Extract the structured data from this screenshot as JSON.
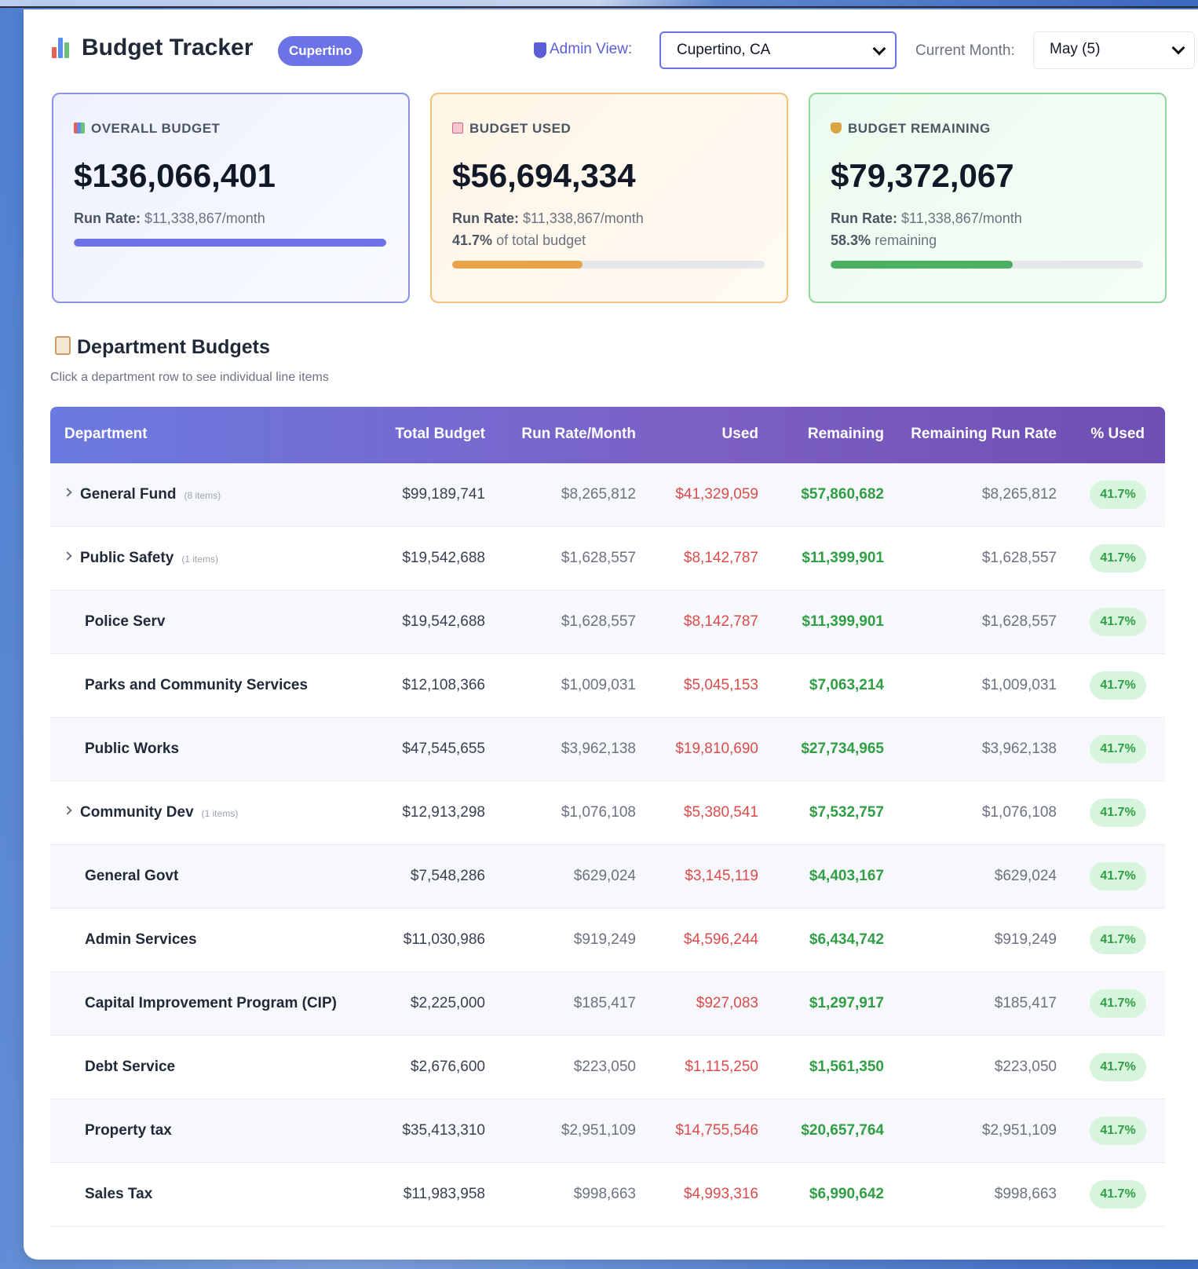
{
  "header": {
    "title": "Budget Tracker",
    "city_badge": "Cupertino",
    "admin_label": "Admin View:",
    "admin_selected": "Cupertino, CA",
    "month_label": "Current Month:",
    "month_selected": "May (5)"
  },
  "cards": {
    "overall": {
      "label": "OVERALL BUDGET",
      "value": "$136,066,401",
      "run_rate_label": "Run Rate:",
      "run_rate_value": "$11,338,867/month",
      "progress": 1.0,
      "color": "#6b73e6"
    },
    "used": {
      "label": "BUDGET USED",
      "value": "$56,694,334",
      "run_rate_label": "Run Rate:",
      "run_rate_value": "$11,338,867/month",
      "pct": "41.7%",
      "pct_text": "of total budget",
      "progress": 0.417,
      "color": "#e8a24a"
    },
    "remaining": {
      "label": "BUDGET REMAINING",
      "value": "$79,372,067",
      "run_rate_label": "Run Rate:",
      "run_rate_value": "$11,338,867/month",
      "pct": "58.3%",
      "pct_text": "remaining",
      "progress": 0.583,
      "color": "#4caf63"
    }
  },
  "section": {
    "title": "Department Budgets",
    "subtitle": "Click a department row to see individual line items"
  },
  "table": {
    "columns": [
      "Department",
      "Total Budget",
      "Run Rate/Month",
      "Used",
      "Remaining",
      "Remaining Run Rate",
      "% Used"
    ],
    "rows": [
      {
        "name": "General Fund",
        "items": "(8 items)",
        "expandable": true,
        "total": "$99,189,741",
        "rate": "$8,265,812",
        "used": "$41,329,059",
        "remaining": "$57,860,682",
        "rrr": "$8,265,812",
        "pct": "41.7%"
      },
      {
        "name": "Public Safety",
        "items": "(1 items)",
        "expandable": true,
        "total": "$19,542,688",
        "rate": "$1,628,557",
        "used": "$8,142,787",
        "remaining": "$11,399,901",
        "rrr": "$1,628,557",
        "pct": "41.7%"
      },
      {
        "name": "Police Serv",
        "items": "",
        "expandable": false,
        "total": "$19,542,688",
        "rate": "$1,628,557",
        "used": "$8,142,787",
        "remaining": "$11,399,901",
        "rrr": "$1,628,557",
        "pct": "41.7%"
      },
      {
        "name": "Parks and Community Services",
        "items": "",
        "expandable": false,
        "total": "$12,108,366",
        "rate": "$1,009,031",
        "used": "$5,045,153",
        "remaining": "$7,063,214",
        "rrr": "$1,009,031",
        "pct": "41.7%"
      },
      {
        "name": "Public Works",
        "items": "",
        "expandable": false,
        "total": "$47,545,655",
        "rate": "$3,962,138",
        "used": "$19,810,690",
        "remaining": "$27,734,965",
        "rrr": "$3,962,138",
        "pct": "41.7%"
      },
      {
        "name": "Community Dev",
        "items": "(1 items)",
        "expandable": true,
        "total": "$12,913,298",
        "rate": "$1,076,108",
        "used": "$5,380,541",
        "remaining": "$7,532,757",
        "rrr": "$1,076,108",
        "pct": "41.7%"
      },
      {
        "name": "General Govt",
        "items": "",
        "expandable": false,
        "total": "$7,548,286",
        "rate": "$629,024",
        "used": "$3,145,119",
        "remaining": "$4,403,167",
        "rrr": "$629,024",
        "pct": "41.7%"
      },
      {
        "name": "Admin Services",
        "items": "",
        "expandable": false,
        "total": "$11,030,986",
        "rate": "$919,249",
        "used": "$4,596,244",
        "remaining": "$6,434,742",
        "rrr": "$919,249",
        "pct": "41.7%"
      },
      {
        "name": "Capital Improvement Program (CIP)",
        "items": "",
        "expandable": false,
        "total": "$2,225,000",
        "rate": "$185,417",
        "used": "$927,083",
        "remaining": "$1,297,917",
        "rrr": "$185,417",
        "pct": "41.7%"
      },
      {
        "name": "Debt Service",
        "items": "",
        "expandable": false,
        "total": "$2,676,600",
        "rate": "$223,050",
        "used": "$1,115,250",
        "remaining": "$1,561,350",
        "rrr": "$223,050",
        "pct": "41.7%"
      },
      {
        "name": "Property tax",
        "items": "",
        "expandable": false,
        "total": "$35,413,310",
        "rate": "$2,951,109",
        "used": "$14,755,546",
        "remaining": "$20,657,764",
        "rrr": "$2,951,109",
        "pct": "41.7%"
      },
      {
        "name": "Sales Tax",
        "items": "",
        "expandable": false,
        "total": "$11,983,958",
        "rate": "$998,663",
        "used": "$4,993,316",
        "remaining": "$6,990,642",
        "rrr": "$998,663",
        "pct": "41.7%"
      }
    ]
  }
}
